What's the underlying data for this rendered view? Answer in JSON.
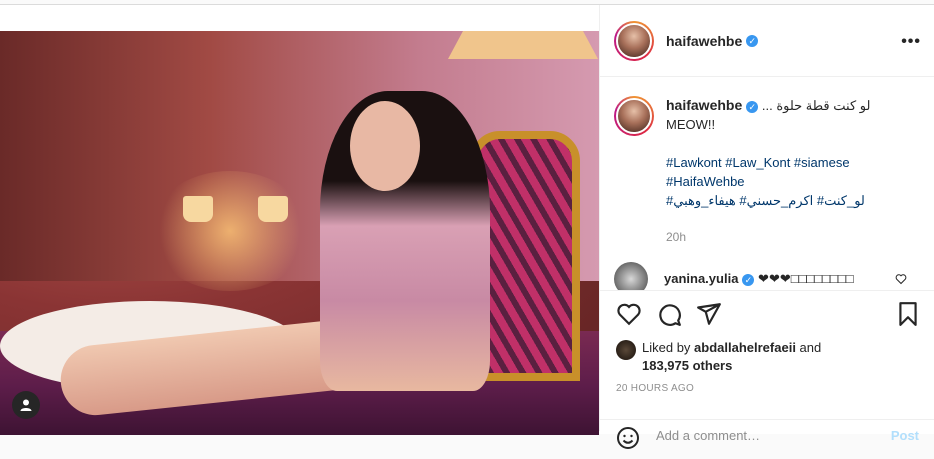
{
  "post": {
    "username": "haifawehbe",
    "verified": true,
    "more_label": "•••"
  },
  "caption": {
    "username": "haifawehbe",
    "arabic_line": "لو كنت قطة حلوة ...",
    "text_line": "MEOW!!",
    "hashtags_line1": "#Lawkont #Law_Kont #siamese",
    "hashtags_line2": "#HaifaWehbe",
    "hashtags_arabic": "لو_كنت# اكرم_حسني# هيفاء_وهبي#",
    "time": "20h"
  },
  "reply": {
    "username": "yanina.yulia",
    "text": "❤❤❤□□□□□□□□"
  },
  "likes": {
    "prefix": "Liked by ",
    "liker": "abdallahelrefaeii",
    "middle": " and",
    "count": "183,975 others"
  },
  "timestamp": "20 HOURS AGO",
  "comment_box": {
    "placeholder": "Add a comment…",
    "post_label": "Post"
  },
  "colors": {
    "link": "#00376b",
    "verified": "#3897f0",
    "muted": "#8e8e8e"
  }
}
